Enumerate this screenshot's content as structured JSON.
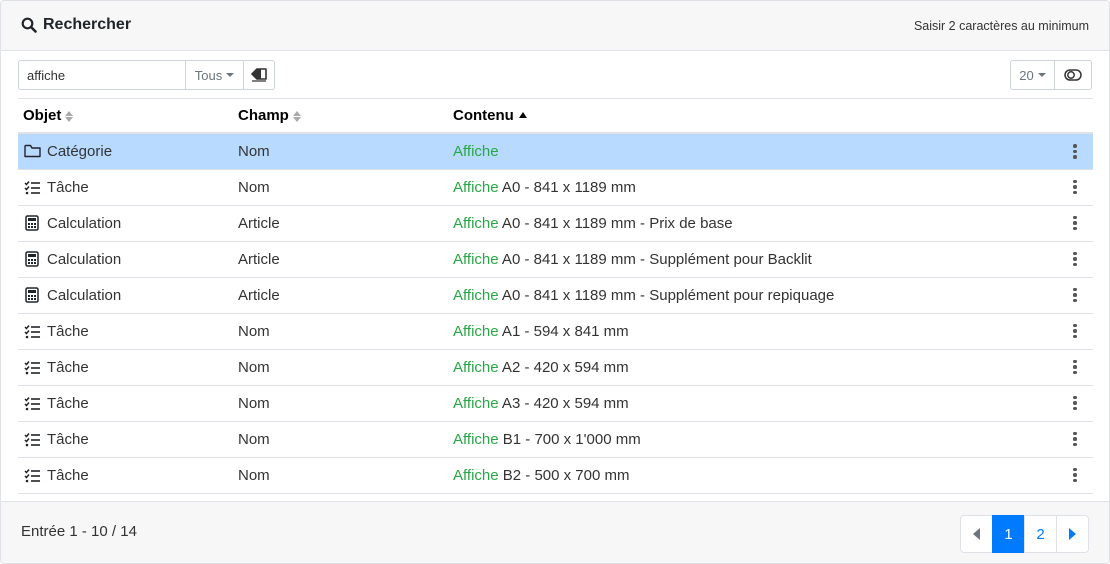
{
  "header": {
    "title": "Rechercher",
    "hint": "Saisir 2 caractères au minimum"
  },
  "toolbar": {
    "search_value": "affiche",
    "filter_label": "Tous",
    "page_size_label": "20"
  },
  "table": {
    "columns": [
      "Objet",
      "Champ",
      "Contenu"
    ],
    "sort": {
      "column": "Contenu",
      "direction": "ascending"
    },
    "rows": [
      {
        "icon": "folder-icon",
        "objet": "Catégorie",
        "champ": "Nom",
        "match": "Affiche",
        "rest": "",
        "selected": true
      },
      {
        "icon": "task-list-icon",
        "objet": "Tâche",
        "champ": "Nom",
        "match": "Affiche",
        "rest": " A0 - 841 x 1189 mm",
        "selected": false
      },
      {
        "icon": "calculator-icon",
        "objet": "Calculation",
        "champ": "Article",
        "match": "Affiche",
        "rest": " A0 - 841 x 1189 mm - Prix de base",
        "selected": false
      },
      {
        "icon": "calculator-icon",
        "objet": "Calculation",
        "champ": "Article",
        "match": "Affiche",
        "rest": " A0 - 841 x 1189 mm - Supplément pour Backlit",
        "selected": false
      },
      {
        "icon": "calculator-icon",
        "objet": "Calculation",
        "champ": "Article",
        "match": "Affiche",
        "rest": " A0 - 841 x 1189 mm - Supplément pour repiquage",
        "selected": false
      },
      {
        "icon": "task-list-icon",
        "objet": "Tâche",
        "champ": "Nom",
        "match": "Affiche",
        "rest": " A1 - 594 x 841 mm",
        "selected": false
      },
      {
        "icon": "task-list-icon",
        "objet": "Tâche",
        "champ": "Nom",
        "match": "Affiche",
        "rest": " A2 - 420 x 594 mm",
        "selected": false
      },
      {
        "icon": "task-list-icon",
        "objet": "Tâche",
        "champ": "Nom",
        "match": "Affiche",
        "rest": " A3 - 420 x 594 mm",
        "selected": false
      },
      {
        "icon": "task-list-icon",
        "objet": "Tâche",
        "champ": "Nom",
        "match": "Affiche",
        "rest": " B1 - 700 x 1'000 mm",
        "selected": false
      },
      {
        "icon": "task-list-icon",
        "objet": "Tâche",
        "champ": "Nom",
        "match": "Affiche",
        "rest": " B2 - 500 x 700 mm",
        "selected": false
      }
    ]
  },
  "footer": {
    "info": "Entrée 1 - 10 / 14",
    "pages": [
      "1",
      "2"
    ],
    "active_page": "1"
  },
  "colors": {
    "highlight": "#28a745",
    "selected_row": "#b8daff",
    "primary": "#007bff"
  }
}
